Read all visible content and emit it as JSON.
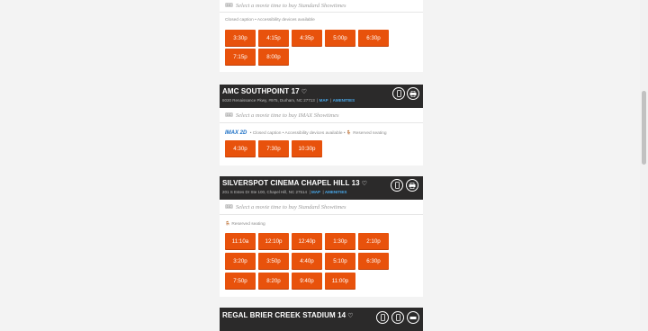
{
  "theaters": [
    {
      "format_prompt": "Select a movie time to buy Standard Showtimes",
      "amenities": "Closed caption • Accessibility devices available",
      "times": [
        "3:30p",
        "4:15p",
        "4:35p",
        "5:00p",
        "6:30p",
        "7:15p",
        "8:00p"
      ]
    },
    {
      "name": "AMC SOUTHPOINT 17",
      "address": "8030 Renaissance Pkwy, #975, Durham, NC 27713",
      "map_label": "MAP",
      "amenities_link": "AMENITIES",
      "format_prompt": "Select a movie time to buy IMAX Showtimes",
      "format_logo": "IMAX 2D",
      "amenities": "• Closed caption • Accessibility devices available •",
      "reserved": "Reserved seating",
      "times": [
        "4:30p",
        "7:30p",
        "10:30p"
      ]
    },
    {
      "name": "SILVERSPOT CINEMA CHAPEL HILL 13",
      "address": "201 S Estes Dr Ste 100, Chapel Hill, NC 27514",
      "map_label": "MAP",
      "amenities_link": "AMENITIES",
      "format_prompt": "Select a movie time to buy Standard Showtimes",
      "reserved": "Reserved seating",
      "times": [
        "11:10a",
        "12:10p",
        "12:40p",
        "1:30p",
        "2:10p",
        "3:20p",
        "3:50p",
        "4:40p",
        "5:10p",
        "6:30p",
        "7:50p",
        "8:20p",
        "9:40p",
        "11:00p"
      ]
    },
    {
      "name": "REGAL BRIER CREEK STADIUM 14"
    }
  ],
  "icons": {
    "heart": "heart-icon",
    "phone": "phone-icon",
    "print": "print-icon",
    "ticket": "ticket-icon",
    "seat": "seat-icon"
  },
  "colors": {
    "accent": "#e8520c",
    "header_bg": "#2b2a2a",
    "link": "#49a7e8"
  }
}
